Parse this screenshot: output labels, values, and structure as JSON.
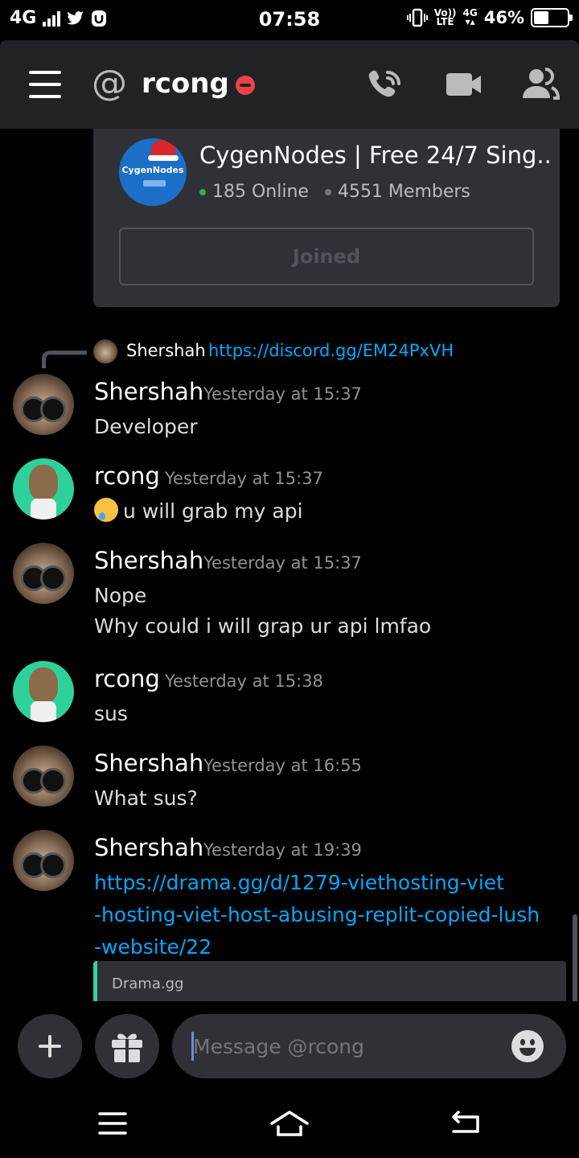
{
  "status_bar": {
    "network": "4G",
    "time": "07:58",
    "volte_top": "Vo))",
    "volte_bottom": "LTE",
    "net2": "4G",
    "battery": "46%",
    "battery_level": 0.46
  },
  "header": {
    "title": "rcong",
    "menu_icon": "hamburger-menu-icon",
    "dm_icon": "at-icon",
    "status_icon": "do-not-disturb-icon",
    "call_icon": "phone-call-icon",
    "video_icon": "video-camera-icon",
    "members_icon": "members-icon"
  },
  "invite": {
    "server_name": "CygenNodes | Free 24/7 Sing..",
    "server_icon_text": "CygenNodes",
    "online": "185 Online",
    "members": "4551 Members",
    "button_label": "Joined"
  },
  "reply": {
    "author": "Shershah",
    "content": "https://discord.gg/EM24PxVH"
  },
  "messages": [
    {
      "author": "Shershah",
      "time": "Yesterday at 15:37",
      "lines": [
        "Developer"
      ]
    },
    {
      "author": "rcong",
      "time": "Yesterday at 15:37",
      "lines": [
        "u will grab my api"
      ]
    },
    {
      "author": "Shershah",
      "time": "Yesterday at 15:37",
      "lines": [
        "Nope",
        "Why could i will grap ur api lmfao"
      ]
    },
    {
      "author": "rcong",
      "time": "Yesterday at 15:38",
      "lines": [
        "sus"
      ]
    },
    {
      "author": "Shershah",
      "time": "Yesterday at 16:55",
      "lines": [
        "What sus?"
      ]
    },
    {
      "author": "Shershah",
      "time": "Yesterday at 19:39",
      "lines": [
        "https://drama.gg/d/1279-viethosting-viet",
        "-hosting-viet-host-abusing-replit-copied-lush",
        "-website/22"
      ]
    }
  ],
  "embed": {
    "provider": "Drama.gg"
  },
  "composer": {
    "placeholder": "Message @rcong",
    "add_icon": "plus-icon",
    "gift_icon": "gift-icon",
    "emoji_icon": "emoji-icon"
  },
  "nav": {
    "menu_icon": "recent-apps-icon",
    "home_icon": "home-icon",
    "back_icon": "back-icon"
  },
  "colors": {
    "background": "#000000",
    "header": "#202225",
    "card": "#2f3136",
    "link": "#00a8fc",
    "dnd": "#ed4245",
    "online": "#3ba55d"
  }
}
